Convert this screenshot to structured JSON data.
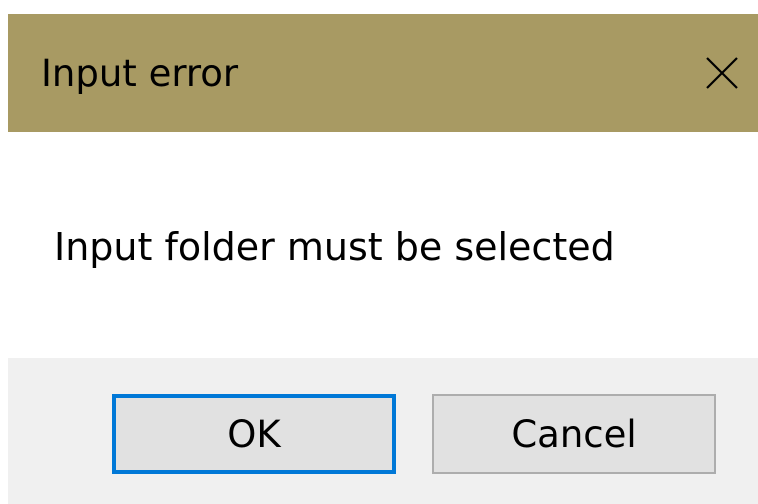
{
  "dialog": {
    "title": "Input error",
    "close_icon": "close-icon",
    "message": "Input folder must be selected",
    "buttons": {
      "ok_label": "OK",
      "cancel_label": "Cancel"
    }
  },
  "colors": {
    "titlebar": "#a89a63",
    "footer": "#f0f0f0",
    "button_face": "#e1e1e1",
    "default_button_border": "#0078d7"
  }
}
